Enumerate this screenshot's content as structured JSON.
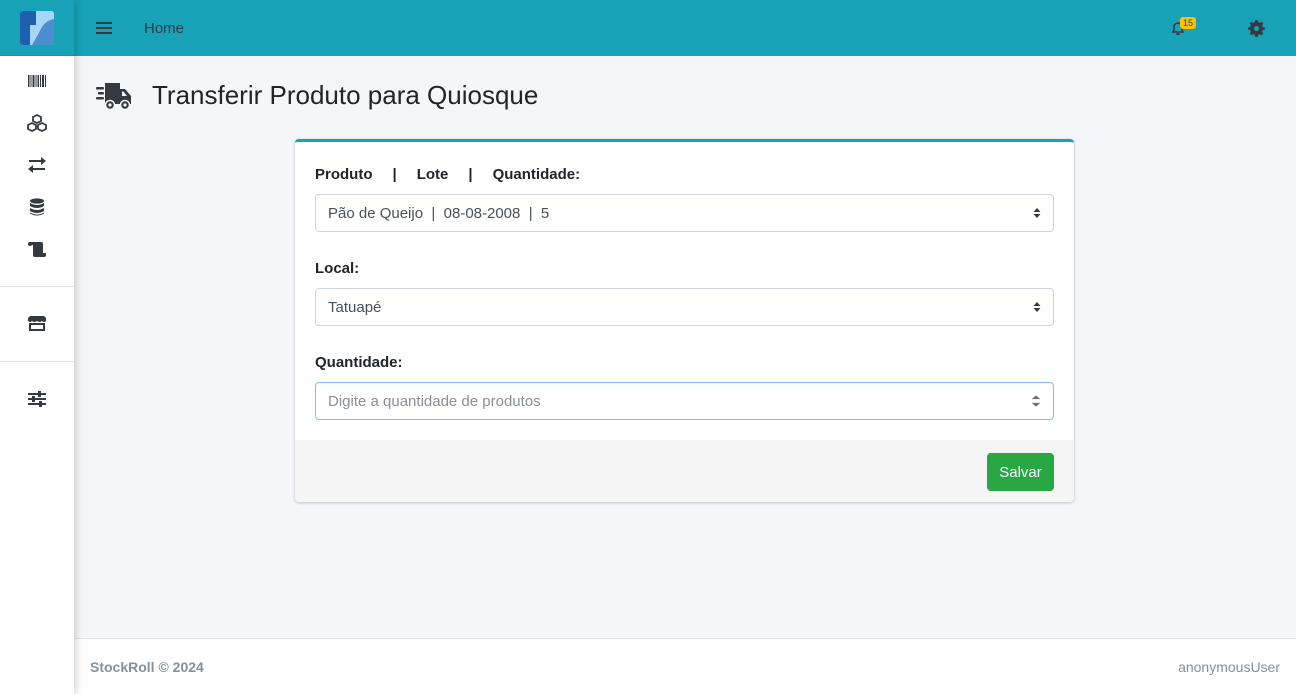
{
  "nav": {
    "home_label": "Home",
    "notification_count": "15"
  },
  "sidebar": {
    "items": [
      {
        "icon": "barcode-icon"
      },
      {
        "icon": "boxes-icon"
      },
      {
        "icon": "exchange-icon"
      },
      {
        "icon": "database-icon"
      },
      {
        "icon": "scroll-icon"
      },
      {
        "icon": "store-icon"
      },
      {
        "icon": "sliders-icon"
      }
    ]
  },
  "page": {
    "title": "Transferir Produto para Quiosque",
    "icon": "truck-fast-icon"
  },
  "form": {
    "product_label_parts": [
      "Produto",
      "|",
      "Lote",
      "|",
      "Quantidade:"
    ],
    "product_value": "Pão de Queijo  |  08-08-2008  |  5",
    "location_label": "Local:",
    "location_value": "Tatuapé",
    "quantity_label": "Quantidade:",
    "quantity_placeholder": "Digite a quantidade de produtos",
    "save_label": "Salvar"
  },
  "footer": {
    "brand": "StockRoll © 2024",
    "user": "anonymousUser"
  },
  "colors": {
    "accent": "#17a2b8",
    "success": "#28a745",
    "badge": "#ffc107"
  }
}
